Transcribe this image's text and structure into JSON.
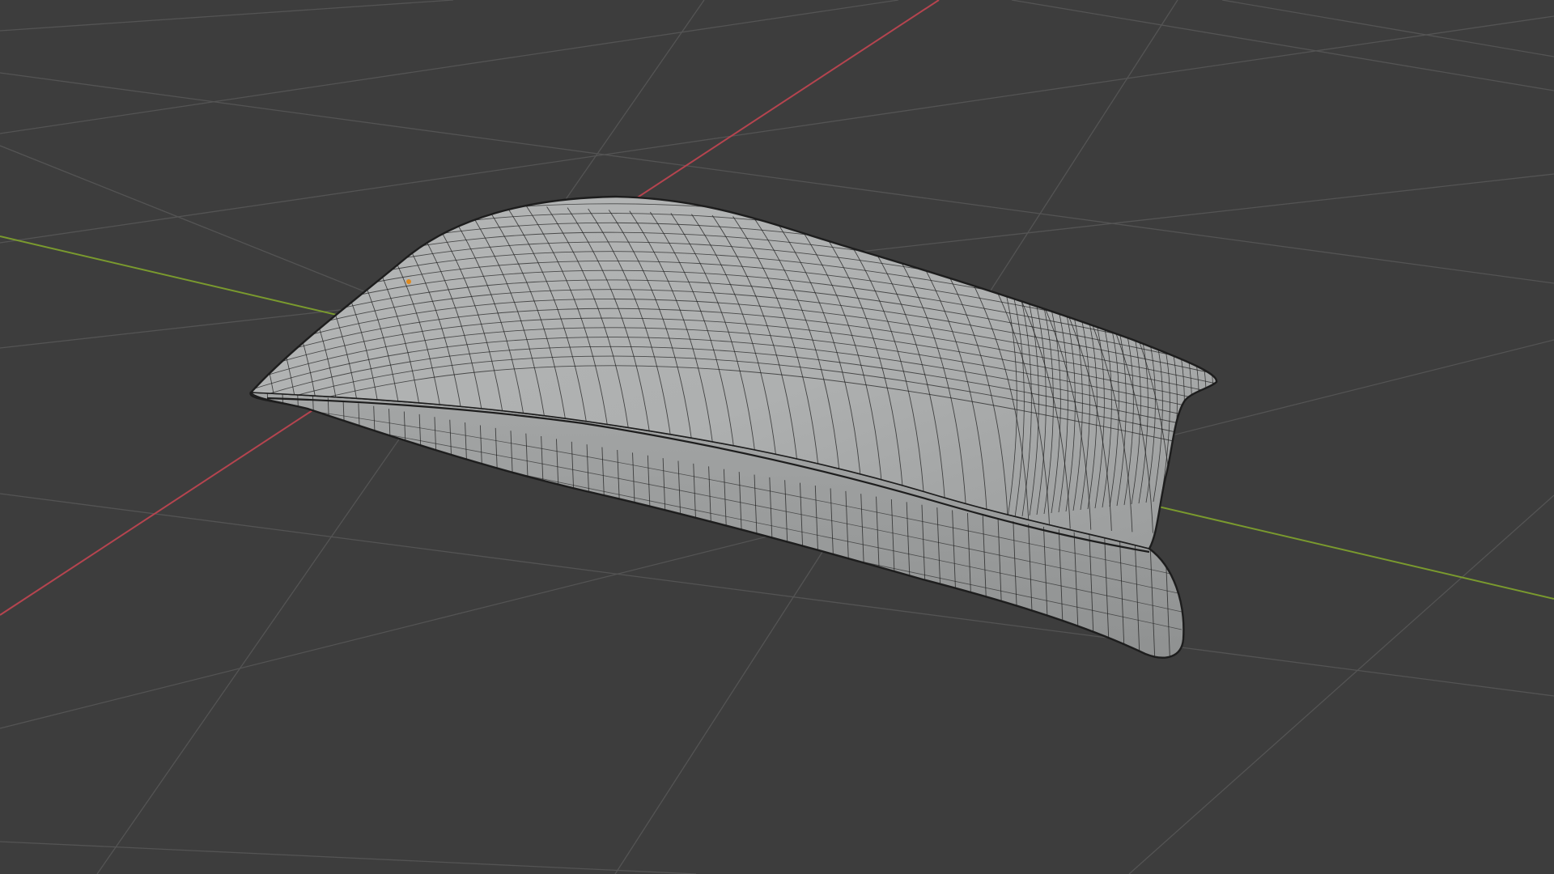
{
  "viewport": {
    "name": "3D Viewport",
    "background_color": "#3d3d3d",
    "grid_line_color": "#545454",
    "x_axis_color": "#b5444f",
    "y_axis_color": "#7a9a2e",
    "mesh_fill_color": "#a9abab",
    "mesh_wire_color": "#1d1d1d",
    "object_origin_color": "#e08a1e",
    "object": {
      "type": "mesh",
      "shape": "pillow",
      "display": "solid-shaded-with-wireframe"
    }
  }
}
